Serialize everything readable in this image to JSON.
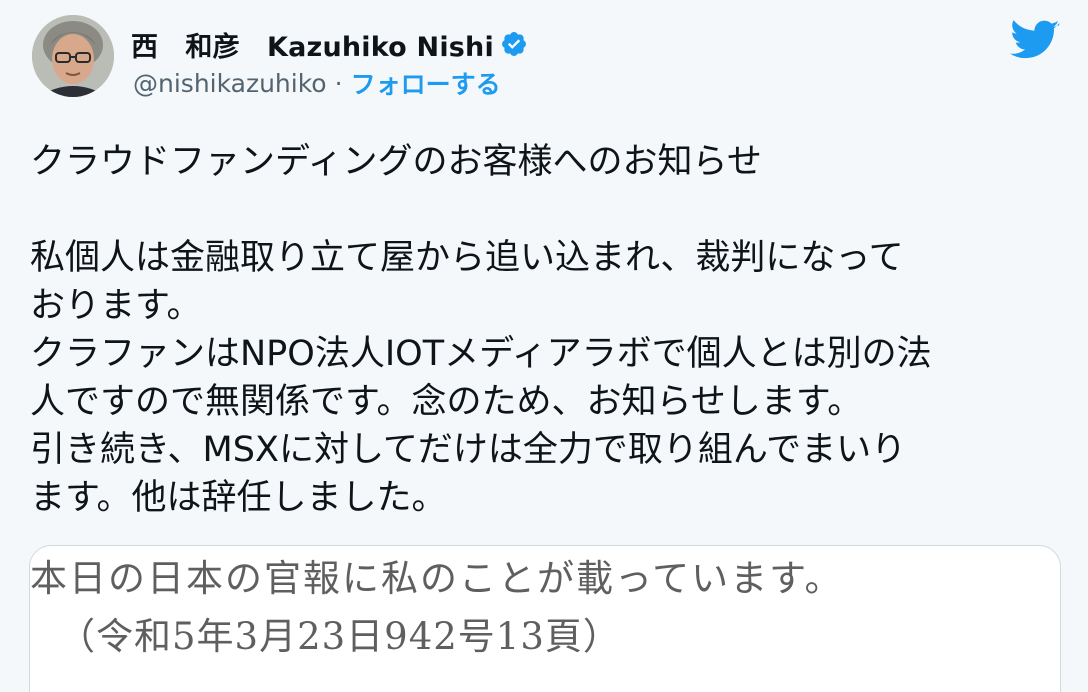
{
  "author": {
    "display_name": "西　和彦　Kazuhiko Nishi",
    "handle": "@nishikazuhiko",
    "separator": "·",
    "follow_label": "フォローする",
    "verified": true
  },
  "icons": {
    "avatar": "avatar-photo",
    "verified": "verified-badge-icon",
    "brand": "twitter-bird-icon"
  },
  "colors": {
    "accent": "#1d9bf0",
    "secondary_text": "#536471",
    "primary_text": "#0f1419",
    "background": "#f5f8fa"
  },
  "tweet": {
    "lines": [
      "クラウドファンディングのお客様へのお知らせ",
      "",
      "私個人は金融取り立て屋から追い込まれ、裁判になって",
      "おります。",
      "クラファンはNPO法人IOTメディアラボで個人とは別の法",
      "人ですので無関係です。念のため、お知らせします。",
      "引き続き、MSXに対してだけは全力で取り組んでまいり",
      "ます。他は辞任しました。"
    ]
  },
  "media": {
    "line1": "本日の日本の官報に私のことが載っています。",
    "line2": "（令和5年3月23日942号13頁）"
  }
}
